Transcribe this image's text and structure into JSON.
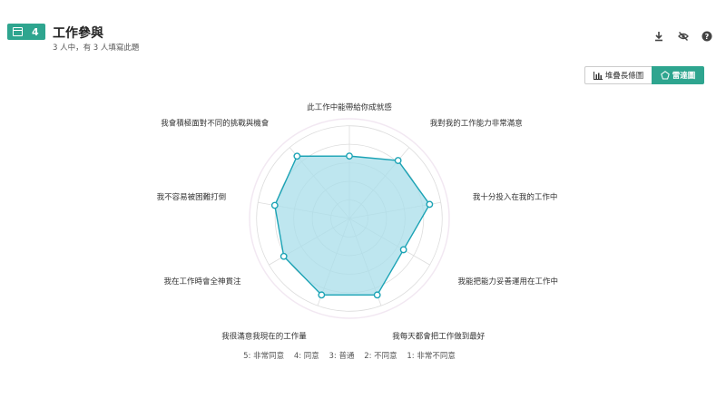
{
  "header": {
    "question_number": "4",
    "title": "工作參與",
    "subtitle": "3 人中，有 3 人填寫此題"
  },
  "toolbar": {
    "download_icon": "download-icon",
    "hide_icon": "eye-off-icon",
    "help_icon": "help-icon"
  },
  "view_toggle": {
    "stacked_label": "堆疊長條圖",
    "radar_label": "雷達圖",
    "active": "radar"
  },
  "colors": {
    "accent": "#2ea58f",
    "series_stroke": "#1ba3b5",
    "series_fill": "#a8dde9",
    "grid": "#dddddd",
    "outer_ring": "#f2e8f2"
  },
  "chart_data": {
    "type": "radar",
    "title": "",
    "axes": [
      "此工作中能帶給你成就感",
      "我對我的工作能力非常滿意",
      "我十分投入在我的工作中",
      "我能把能力妥善運用在工作中",
      "我每天都會把工作做到最好",
      "我很滿意我現在的工作量",
      "我在工作時會全神貫注",
      "我不容易被困難打倒",
      "我會積極面對不同的挑戰與機會"
    ],
    "values": [
      3.3,
      4.0,
      4.3,
      3.3,
      4.3,
      4.3,
      4.0,
      4.0,
      4.3
    ],
    "range": [
      0,
      5
    ],
    "grid_levels": [
      1,
      2,
      3,
      4,
      5
    ],
    "scale_legend": [
      "5: 非常同意",
      "4: 同意",
      "3: 普通",
      "2: 不同意",
      "1: 非常不同意"
    ]
  }
}
